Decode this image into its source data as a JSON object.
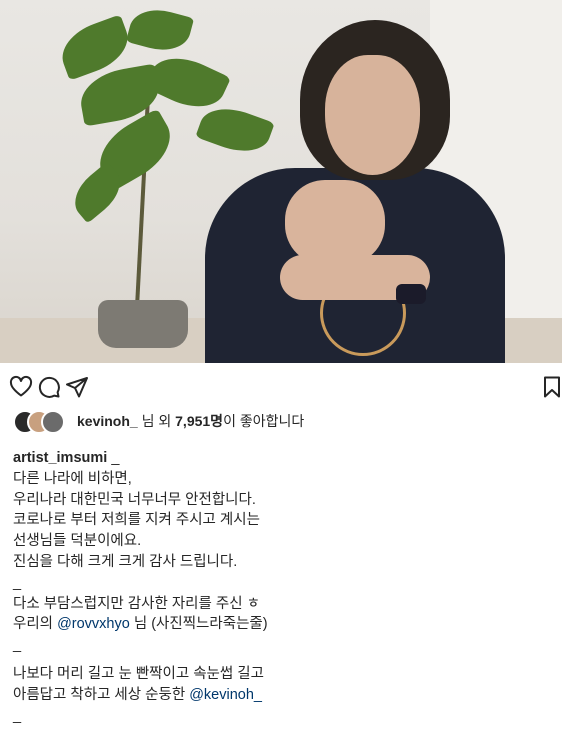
{
  "post": {
    "image_alt": "post photo",
    "likes": {
      "name": "kevinoh_",
      "middle": " 님 외 ",
      "count": "7,951명",
      "suffix": "이 좋아합니다"
    },
    "caption": {
      "username": "artist_imsumi",
      "username_suffix": " _",
      "lines": [
        "다른 나라에 비하면,",
        "우리나라 대한민국 너무너무 안전합니다.",
        "코로나로 부터 저희를 지켜 주시고 계시는",
        "선생님들 덕분이에요.",
        "진심을 다해 크게 크게 감사 드립니다.",
        "_",
        "다소 부담스럽지만 감사한 자리를 주신 ㅎ",
        "우리의 ",
        "@rovvxhyo",
        " 님 (사진찍느라죽는줄)",
        "_",
        "나보다 머리 길고 눈 빤짝이고 속눈썹 길고",
        "아름답고 착하고 세상 순둥한 ",
        "@kevinoh_",
        "_"
      ]
    }
  },
  "icons": {
    "like": "heart-icon",
    "comment": "comment-icon",
    "share": "share-icon",
    "save": "bookmark-icon"
  },
  "colors": {
    "text": "#262626",
    "mention": "#00376b",
    "background": "#ffffff"
  }
}
